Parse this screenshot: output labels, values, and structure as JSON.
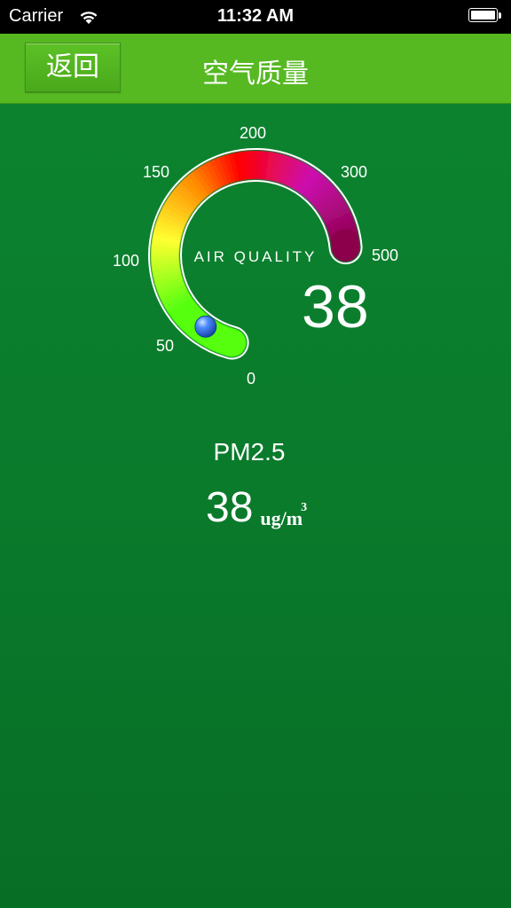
{
  "status_bar": {
    "carrier": "Carrier",
    "time": "11:32 AM",
    "icons": [
      "wifi-icon",
      "battery-icon"
    ]
  },
  "nav": {
    "back_label": "返回",
    "title": "空气质量"
  },
  "gauge": {
    "caption": "AIR QUALITY",
    "scale_labels": [
      "0",
      "50",
      "100",
      "150",
      "200",
      "300",
      "500"
    ],
    "value": "38",
    "value_num": 38,
    "colors": {
      "good": "#55ff10",
      "moderate": "#ffff30",
      "sensitive": "#ff8c00",
      "unhealthy": "#ff0000",
      "very_unhealthy": "#cc10b0",
      "hazardous": "#8a0048",
      "indicator": "#2a6ee0"
    }
  },
  "pm25": {
    "label": "PM2.5",
    "value": "38",
    "unit": "ug/m",
    "unit_sup": "3"
  },
  "theme": {
    "background": "#0a7d2c",
    "nav_bar": "#56b922"
  }
}
